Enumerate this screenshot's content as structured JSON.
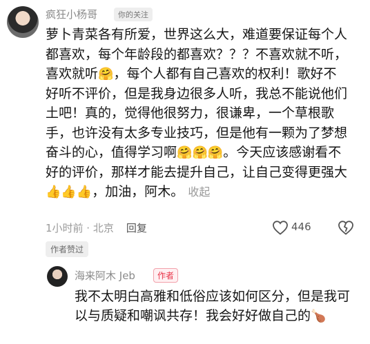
{
  "comment": {
    "username": "疯狂小杨哥",
    "follow_badge": "你的关注",
    "seg1": "萝卜青菜各有所爱，世界这么大，难道要保证每个人都喜欢，每个年龄段的都喜欢？？？不喜欢就不听，喜欢就听",
    "seg2": "，每个人都有自己喜欢的权利！歌好不好听不评价，但是我身边很多人听，我总不能说他们土吧！真的，觉得他很努力，很谦卑，一个草根歌手，也许没有太多专业技巧，但是他有一颗为了梦想奋斗的心，值得学习啊",
    "seg3": "。今天应该感谢看不好的评价，那样才能去提升自己，让自己变得更强大",
    "seg4": "，加油，阿木。",
    "collapse_label": "收起",
    "emoji_hug": "🤗",
    "emoji_thumbs": "👍",
    "timestamp": "1小时前 · 北京",
    "reply_label": "回复",
    "like_count": "446",
    "author_liked": "作者赞过"
  },
  "reply": {
    "username": "海来阿木 Jeb",
    "author_badge": "作者",
    "text": "我不太明白高雅和低俗应该如何区分，但是我可以与质疑和嘲讽共存！我会好好做自己的",
    "emoji_drumstick": "🍗"
  }
}
